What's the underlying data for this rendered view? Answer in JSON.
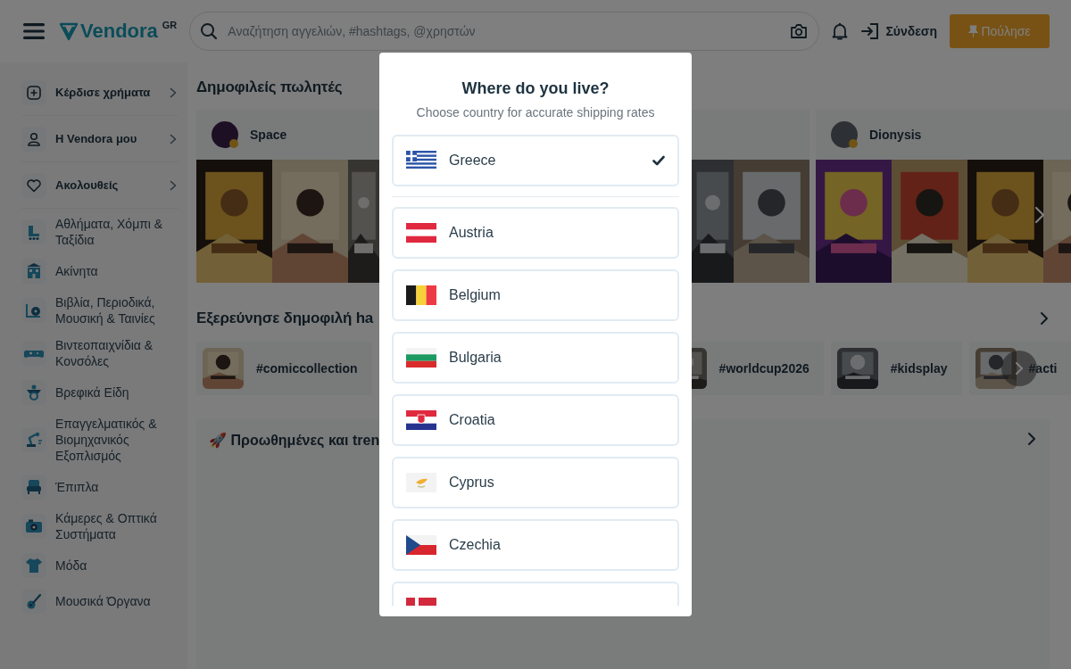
{
  "header": {
    "logo": "Vendora",
    "region": "GR",
    "search": {
      "placeholder": "Αναζήτηση αγγελιών, #hashtags, @χρηστών"
    },
    "login": "Σύνδεση",
    "sell": "Πούλησε"
  },
  "sidebar": {
    "menu": [
      {
        "label": "Κέρδισε χρήματα"
      },
      {
        "label": "Η Vendora μου"
      },
      {
        "label": "Ακολουθείς"
      }
    ],
    "categories": [
      {
        "label": "Αθλήματα, Χόμπι & Ταξίδια"
      },
      {
        "label": "Ακίνητα"
      },
      {
        "label": "Βιβλία, Περιοδικά, Μουσική & Ταινίες"
      },
      {
        "label": "Βιντεοπαιχνίδια & Κονσόλες"
      },
      {
        "label": "Βρεφικά Είδη"
      },
      {
        "label": "Επαγγελματικός & Βιομηχανικός Εξοπλισμός"
      },
      {
        "label": "Έπιπλα"
      },
      {
        "label": "Κάμερες & Οπτικά Συστήματα"
      },
      {
        "label": "Μόδα"
      },
      {
        "label": "Μουσικά Όργανα"
      }
    ]
  },
  "sellers": {
    "title": "Δημοφιλείς πωλητές",
    "items": [
      {
        "name": "Space"
      },
      {
        "name": "Dionysis"
      }
    ]
  },
  "hashtags": {
    "title": "Εξερεύνησε δημοφιλή ha",
    "items": [
      {
        "tag": "#comiccollection"
      },
      {
        "tag": "#worldcup2026"
      },
      {
        "tag": "#kidsplay"
      },
      {
        "tag": "#acti"
      }
    ]
  },
  "promoted": {
    "title": "🚀 Προωθημένες και tren"
  },
  "modal": {
    "title": "Where do you live?",
    "subtitle": "Choose country for accurate shipping rates",
    "countries": [
      {
        "name": "Greece",
        "selected": true
      },
      {
        "name": "Austria",
        "selected": false
      },
      {
        "name": "Belgium",
        "selected": false
      },
      {
        "name": "Bulgaria",
        "selected": false
      },
      {
        "name": "Croatia",
        "selected": false
      },
      {
        "name": "Cyprus",
        "selected": false
      },
      {
        "name": "Czechia",
        "selected": false
      },
      {
        "selected": false
      }
    ]
  }
}
